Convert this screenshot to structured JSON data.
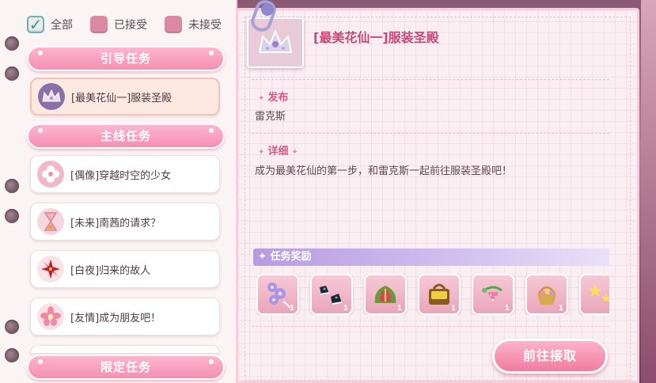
{
  "filters": [
    {
      "label": "全部",
      "checked": true
    },
    {
      "label": "已接受",
      "checked": false
    },
    {
      "label": "未接受",
      "checked": false
    }
  ],
  "categories": {
    "guide": "引导任务",
    "main": "主线任务",
    "limited": "限定任务"
  },
  "tasks": [
    {
      "label": "[最美花仙一]服装圣殿",
      "icon": "crown-icon",
      "selected": true
    },
    {
      "label": "[偶像]穿越时空的少女",
      "icon": "flower-icon",
      "selected": false
    },
    {
      "label": "[未来]南茜的请求？",
      "icon": "hourglass-icon",
      "selected": false
    },
    {
      "label": "[白夜]归来的故人",
      "icon": "red-lily-icon",
      "selected": false
    },
    {
      "label": "[友情]成为朋友吧！",
      "icon": "pink-flower-icon",
      "selected": false
    }
  ],
  "detail": {
    "title": "[最美花仙一]服装圣殿",
    "publisher_label": "发布",
    "publisher": "雷克斯",
    "detail_label": "详细",
    "description": "成为最美花仙的第一步，和雷克斯一起前往服装圣殿吧！",
    "reward_label": "任务奖励",
    "rewards": [
      {
        "icon": "purple-flower-hairpiece-icon",
        "qty": "1"
      },
      {
        "icon": "sneakers-icon",
        "qty": "1"
      },
      {
        "icon": "green-bag-icon",
        "qty": "1"
      },
      {
        "icon": "bread-tote-icon",
        "qty": "1"
      },
      {
        "icon": "strawberry-charm-icon",
        "qty": "1"
      },
      {
        "icon": "flower-basket-icon",
        "qty": "1"
      },
      {
        "icon": "stars-icon",
        "qty": ""
      }
    ],
    "button_label": "前往接取"
  },
  "colors": {
    "accent_pink": "#f07c9f",
    "title_pink": "#c44a78",
    "reward_bar": "#b79be0"
  }
}
